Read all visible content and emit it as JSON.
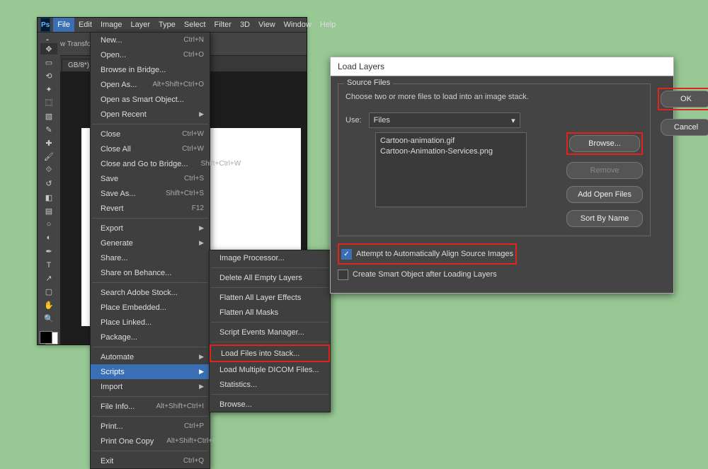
{
  "menubar": {
    "items": [
      "File",
      "Edit",
      "Image",
      "Layer",
      "Type",
      "Select",
      "Filter",
      "3D",
      "View",
      "Window",
      "Help"
    ],
    "open_index": 0
  },
  "options_bar": {
    "transform_label": "w Transform Controls"
  },
  "doc_tab": {
    "label": "GB/8*) ×"
  },
  "file_menu": {
    "groups": [
      [
        {
          "l": "New...",
          "s": "Ctrl+N"
        },
        {
          "l": "Open...",
          "s": "Ctrl+O"
        },
        {
          "l": "Browse in Bridge...",
          "s": ""
        },
        {
          "l": "Open As...",
          "s": "Alt+Shift+Ctrl+O"
        },
        {
          "l": "Open as Smart Object...",
          "s": ""
        },
        {
          "l": "Open Recent",
          "s": "",
          "sub": true
        }
      ],
      [
        {
          "l": "Close",
          "s": "Ctrl+W"
        },
        {
          "l": "Close All",
          "s": "Ctrl+W"
        },
        {
          "l": "Close and Go to Bridge...",
          "s": "Shift+Ctrl+W"
        },
        {
          "l": "Save",
          "s": "Ctrl+S"
        },
        {
          "l": "Save As...",
          "s": "Shift+Ctrl+S"
        },
        {
          "l": "Revert",
          "s": "F12"
        }
      ],
      [
        {
          "l": "Export",
          "s": "",
          "sub": true
        },
        {
          "l": "Generate",
          "s": "",
          "sub": true
        },
        {
          "l": "Share...",
          "s": ""
        },
        {
          "l": "Share on Behance...",
          "s": ""
        }
      ],
      [
        {
          "l": "Search Adobe Stock...",
          "s": ""
        },
        {
          "l": "Place Embedded...",
          "s": ""
        },
        {
          "l": "Place Linked...",
          "s": ""
        },
        {
          "l": "Package...",
          "s": ""
        }
      ],
      [
        {
          "l": "Automate",
          "s": "",
          "sub": true
        },
        {
          "l": "Scripts",
          "s": "",
          "sub": true,
          "hl": true
        },
        {
          "l": "Import",
          "s": "",
          "sub": true
        }
      ],
      [
        {
          "l": "File Info...",
          "s": "Alt+Shift+Ctrl+I"
        }
      ],
      [
        {
          "l": "Print...",
          "s": "Ctrl+P"
        },
        {
          "l": "Print One Copy",
          "s": "Alt+Shift+Ctrl+P"
        }
      ],
      [
        {
          "l": "Exit",
          "s": "Ctrl+Q"
        }
      ]
    ]
  },
  "scripts_submenu": {
    "groups": [
      [
        {
          "l": "Image Processor..."
        }
      ],
      [
        {
          "l": "Delete All Empty Layers"
        }
      ],
      [
        {
          "l": "Flatten All Layer Effects"
        },
        {
          "l": "Flatten All Masks"
        }
      ],
      [
        {
          "l": "Script Events Manager..."
        }
      ],
      [
        {
          "l": "Load Files into Stack...",
          "box": true
        },
        {
          "l": "Load Multiple DICOM Files..."
        },
        {
          "l": "Statistics..."
        }
      ],
      [
        {
          "l": "Browse..."
        }
      ]
    ]
  },
  "dialog": {
    "title": "Load Layers",
    "group_label": "Source Files",
    "help": "Choose two or more files to load into an image stack.",
    "use_label": "Use:",
    "use_value": "Files",
    "files": [
      "Cartoon-animation.gif",
      "Cartoon-Animation-Services.png"
    ],
    "btn_browse": "Browse...",
    "btn_remove": "Remove",
    "btn_addopen": "Add Open Files",
    "btn_sort": "Sort By Name",
    "chk_align": "Attempt to Automatically Align Source Images",
    "chk_smart": "Create Smart Object after Loading Layers",
    "btn_ok": "OK",
    "btn_cancel": "Cancel"
  },
  "tools": [
    "move",
    "marquee",
    "lasso",
    "wand",
    "crop",
    "frame",
    "eyedrop",
    "heal",
    "brush",
    "stamp",
    "history",
    "eraser",
    "gradient",
    "blur",
    "dodge",
    "pen",
    "type",
    "path",
    "rect",
    "hand",
    "zoom"
  ]
}
